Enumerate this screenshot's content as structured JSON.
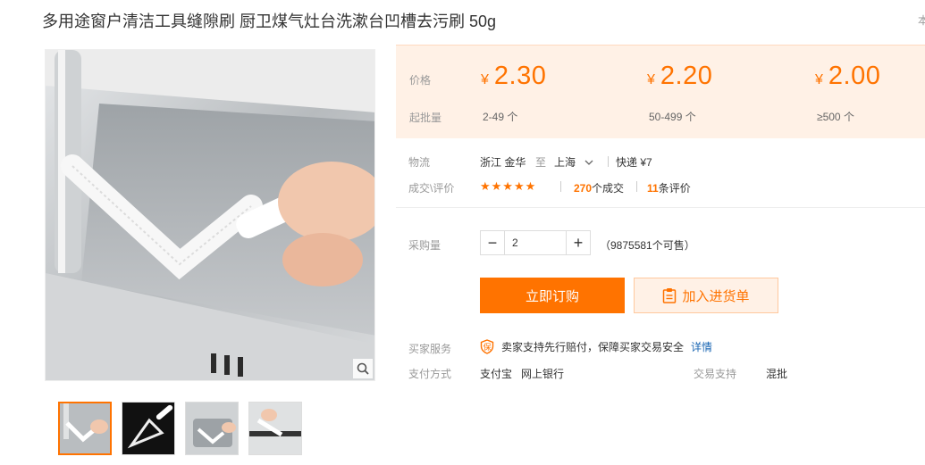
{
  "product": {
    "title": "多用途窗户清洁工具缝隙刷 厨卫煤气灶台洗漱台凹槽去污刷 50g",
    "title_overflow": "本"
  },
  "price_panel": {
    "price_label": "价格",
    "batch_label": "起批量",
    "currency": "¥",
    "tiers": [
      {
        "price": "2.30",
        "batch": "2-49 个"
      },
      {
        "price": "2.20",
        "batch": "50-499 个"
      },
      {
        "price": "2.00",
        "batch": "≥500 个"
      }
    ]
  },
  "logistics": {
    "label": "物流",
    "from": "浙江 金华",
    "to_word": "至",
    "to": "上海",
    "shipping": "快递 ¥7"
  },
  "reviews": {
    "label": "成交\\评价",
    "stars": "★★★★★",
    "deals_count": "270",
    "deals_suffix": "个成交",
    "reviews_count": "11",
    "reviews_suffix": "条评价"
  },
  "purchase": {
    "label": "采购量",
    "minus": "−",
    "plus": "+",
    "quantity": "2",
    "stock": "（9875581个可售）",
    "buy_now": "立即订购",
    "add_to_list": "加入进货单"
  },
  "services": {
    "label": "买家服务",
    "badge_char": "保",
    "text": "卖家支持先行赔付，保障买家交易安全",
    "detail_link": "详情",
    "payment_label": "支付方式",
    "payment_methods": [
      "支付宝",
      "网上银行"
    ],
    "trade_label": "交易支持",
    "trade_value": "混批"
  },
  "colors": {
    "accent": "#ff7300",
    "price_bg": "#fff1e6",
    "link": "#1a66b3"
  },
  "icons": {
    "zoom": "magnifier-icon",
    "dropdown": "chevron-down-icon",
    "cart_list": "clipboard-icon",
    "guarantee": "shield-badge-icon"
  }
}
